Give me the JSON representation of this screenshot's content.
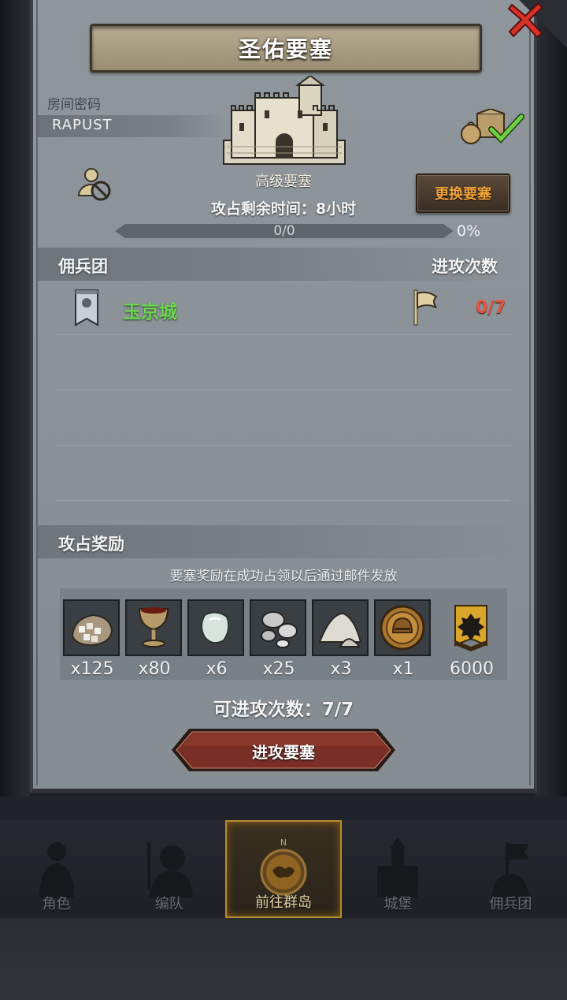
{
  "title": "圣佑要塞",
  "room": {
    "label": "房间密码",
    "code": "RAPUST"
  },
  "fortress": {
    "name": "高级要塞",
    "time_label": "攻占剩余时间：8小时",
    "change_button": "更换要塞",
    "progress_text": "0/0",
    "progress_percent": "0%",
    "progress_value": 0
  },
  "guild_section": {
    "title": "佣兵团",
    "right_title": "进攻次数",
    "rows": [
      {
        "name": "玉京城",
        "attacks": "0/7"
      }
    ]
  },
  "reward_section": {
    "title": "攻占奖励",
    "note": "要塞奖励在成功占领以后通过邮件发放",
    "items": [
      {
        "icon": "ore-sack-icon",
        "count": "x125"
      },
      {
        "icon": "goblet-icon",
        "count": "x80"
      },
      {
        "icon": "gem-stone-icon",
        "count": "x6"
      },
      {
        "icon": "silver-mushroom-icon",
        "count": "x25"
      },
      {
        "icon": "powder-pile-icon",
        "count": "x3"
      },
      {
        "icon": "helmet-coin-icon",
        "count": "x1"
      },
      {
        "icon": "guild-emblem-icon",
        "count": "6000"
      }
    ]
  },
  "remaining_attacks": "可进攻次数：7/7",
  "attack_button": "进攻要塞",
  "nav": {
    "items": [
      {
        "label": "角色",
        "icon": "knight-icon"
      },
      {
        "label": "编队",
        "icon": "army-icon"
      },
      {
        "label": "前往群岛",
        "icon": "compass-map-icon",
        "active": true
      },
      {
        "label": "城堡",
        "icon": "castle-icon"
      },
      {
        "label": "佣兵团",
        "icon": "mercenary-icon"
      }
    ],
    "compass_letter": "N"
  },
  "colors": {
    "guild_name": "#6fd456",
    "attack_count": "#e3543f",
    "change_button_text": "#f2a33a",
    "close_x": "#d6322a"
  }
}
